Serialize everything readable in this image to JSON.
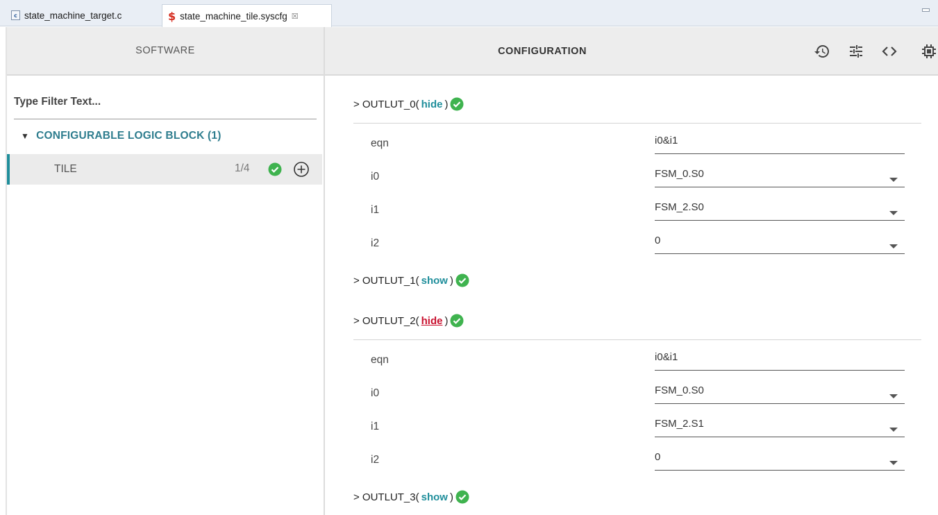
{
  "tabs": [
    {
      "label": "state_machine_target.c",
      "icon": "c-file-icon",
      "active": false
    },
    {
      "label": "state_machine_tile.syscfg",
      "icon": "syscfg-file-icon",
      "active": true,
      "close": "☒"
    }
  ],
  "software_panel": {
    "header": "SOFTWARE",
    "filter_placeholder": "Type Filter Text...",
    "group_label": "CONFIGURABLE LOGIC BLOCK (1)",
    "item": {
      "label": "TILE",
      "count": "1/4"
    }
  },
  "config_panel": {
    "header": "CONFIGURATION",
    "toolbar_icons": [
      "history-icon",
      "sliders-icon",
      "code-icon",
      "chip-icon"
    ],
    "sections": [
      {
        "prefix": "> OUTLUT_0(",
        "toggle": "hide",
        "suffix": ")",
        "expanded": true,
        "fields": [
          {
            "label": "eqn",
            "value": "i0&i1",
            "dropdown": false
          },
          {
            "label": "i0",
            "value": "FSM_0.S0",
            "dropdown": true
          },
          {
            "label": "i1",
            "value": "FSM_2.S0",
            "dropdown": true
          },
          {
            "label": "i2",
            "value": "0",
            "dropdown": true
          }
        ]
      },
      {
        "prefix": "> OUTLUT_1(",
        "toggle": "show",
        "suffix": ")",
        "expanded": false
      },
      {
        "prefix": "> OUTLUT_2(",
        "toggle": "hide",
        "suffix": ")",
        "expanded": true,
        "hovered": true,
        "fields": [
          {
            "label": "eqn",
            "value": "i0&i1",
            "dropdown": false
          },
          {
            "label": "i0",
            "value": "FSM_0.S0",
            "dropdown": true
          },
          {
            "label": "i1",
            "value": "FSM_2.S1",
            "dropdown": true
          },
          {
            "label": "i2",
            "value": "0",
            "dropdown": true
          }
        ]
      },
      {
        "prefix": "> OUTLUT_3(",
        "toggle": "show",
        "suffix": ")",
        "expanded": false
      }
    ]
  },
  "colors": {
    "accent": "#1f8e9b",
    "check_green": "#3fb34f",
    "link_hover_red": "#c8102e"
  }
}
